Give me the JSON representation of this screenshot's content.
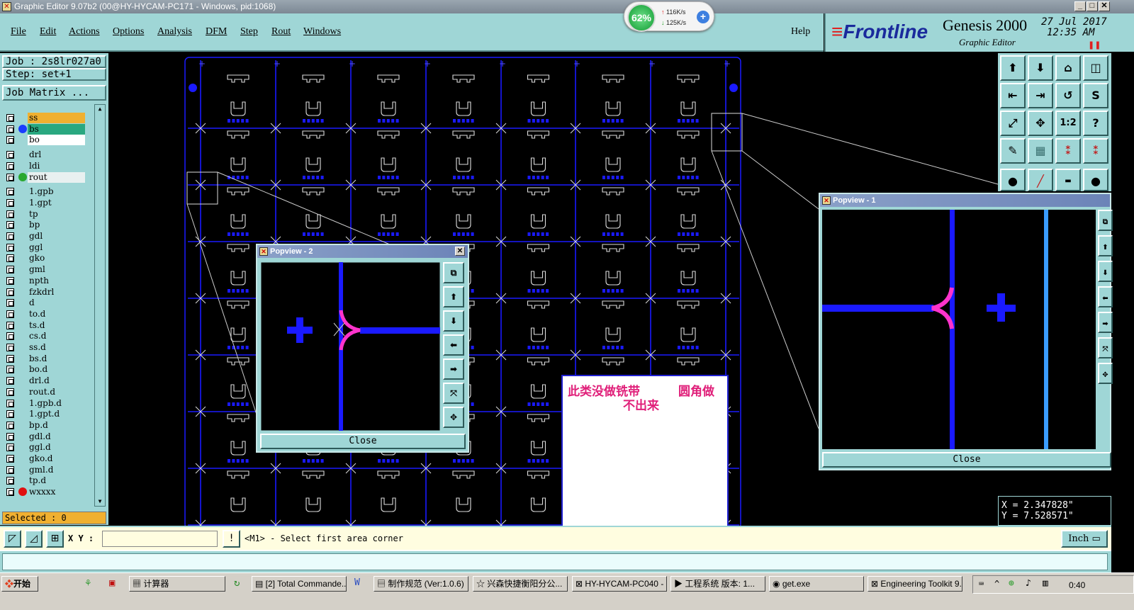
{
  "window": {
    "title": "Graphic Editor 9.07b2 (00@HY-HYCAM-PC171 - Windows, pid:1068)"
  },
  "netmon": {
    "percent": "62%",
    "up": "116K/s",
    "down": "125K/s"
  },
  "menu": [
    "File",
    "Edit",
    "Actions",
    "Options",
    "Analysis",
    "DFM",
    "Step",
    "Rout",
    "Windows"
  ],
  "help_label": "Help",
  "brand": {
    "logo": "Frontline",
    "product": "Genesis 2000",
    "sub": "Graphic Editor",
    "date": "27 Jul 2017",
    "time": "12:35 AM"
  },
  "job": {
    "job_line": "Job : 2s8lr027a0",
    "step_line": "Step: set+1",
    "matrix_button": "Job Matrix ..."
  },
  "layers": [
    {
      "name": "ss",
      "color": "#f0b030",
      "dot": ""
    },
    {
      "name": "bs",
      "color": "#2aa880",
      "dot": "#1a3cff"
    },
    {
      "name": "bo",
      "color": "#ffffff",
      "dot": ""
    },
    {
      "name": "drl",
      "color": "#9fd6d6",
      "dot": ""
    },
    {
      "name": "ldi",
      "color": "#9fd6d6",
      "dot": ""
    },
    {
      "name": "rout",
      "color": "#e8f0f0",
      "dot": "#2aa830"
    },
    {
      "name": "1.gpb",
      "color": "#9fd6d6",
      "dot": ""
    },
    {
      "name": "1.gpt",
      "color": "#9fd6d6",
      "dot": ""
    },
    {
      "name": "tp",
      "color": "#9fd6d6",
      "dot": ""
    },
    {
      "name": "bp",
      "color": "#9fd6d6",
      "dot": ""
    },
    {
      "name": "gdl",
      "color": "#9fd6d6",
      "dot": ""
    },
    {
      "name": "ggl",
      "color": "#9fd6d6",
      "dot": ""
    },
    {
      "name": "gko",
      "color": "#9fd6d6",
      "dot": ""
    },
    {
      "name": "gml",
      "color": "#9fd6d6",
      "dot": ""
    },
    {
      "name": "npth",
      "color": "#9fd6d6",
      "dot": ""
    },
    {
      "name": "fzkdrl",
      "color": "#9fd6d6",
      "dot": ""
    },
    {
      "name": "d",
      "color": "#9fd6d6",
      "dot": ""
    },
    {
      "name": "to.d",
      "color": "#9fd6d6",
      "dot": ""
    },
    {
      "name": "ts.d",
      "color": "#9fd6d6",
      "dot": ""
    },
    {
      "name": "cs.d",
      "color": "#9fd6d6",
      "dot": ""
    },
    {
      "name": "ss.d",
      "color": "#9fd6d6",
      "dot": ""
    },
    {
      "name": "bs.d",
      "color": "#9fd6d6",
      "dot": ""
    },
    {
      "name": "bo.d",
      "color": "#9fd6d6",
      "dot": ""
    },
    {
      "name": "drl.d",
      "color": "#9fd6d6",
      "dot": ""
    },
    {
      "name": "rout.d",
      "color": "#9fd6d6",
      "dot": ""
    },
    {
      "name": "1.gpb.d",
      "color": "#9fd6d6",
      "dot": ""
    },
    {
      "name": "1.gpt.d",
      "color": "#9fd6d6",
      "dot": ""
    },
    {
      "name": "bp.d",
      "color": "#9fd6d6",
      "dot": ""
    },
    {
      "name": "gdl.d",
      "color": "#9fd6d6",
      "dot": ""
    },
    {
      "name": "ggl.d",
      "color": "#9fd6d6",
      "dot": ""
    },
    {
      "name": "gko.d",
      "color": "#9fd6d6",
      "dot": ""
    },
    {
      "name": "gml.d",
      "color": "#9fd6d6",
      "dot": ""
    },
    {
      "name": "tp.d",
      "color": "#9fd6d6",
      "dot": ""
    },
    {
      "name": "wxxxx",
      "color": "#9fd6d6",
      "dot": "#e01010"
    }
  ],
  "selected": "Selected : 0",
  "popview2": {
    "title": "Popview - 2",
    "close": "Close"
  },
  "popview1": {
    "title": "Popview - 1",
    "close": "Close"
  },
  "note": {
    "line1": "此类没做铣带",
    "line1b": "圆角做",
    "line2": "不出来"
  },
  "coords": {
    "x": "X = 2.347828\"",
    "y": "Y = 7.528571\""
  },
  "bottom": {
    "xy_label": "X Y :",
    "prompt": "<M1> - Select first area corner",
    "units": "Inch"
  },
  "taskbar": {
    "start": "开始",
    "items": [
      "计算器",
      "[2] Total Commande...",
      "制作规范 (Ver:1.0.6)",
      "兴森快捷衡阳分公...",
      "HY-HYCAM-PC040 - ...",
      "工程系统  版本: 1...",
      "get.exe",
      "Engineering Toolkit 9..."
    ],
    "clock": "0:40"
  }
}
